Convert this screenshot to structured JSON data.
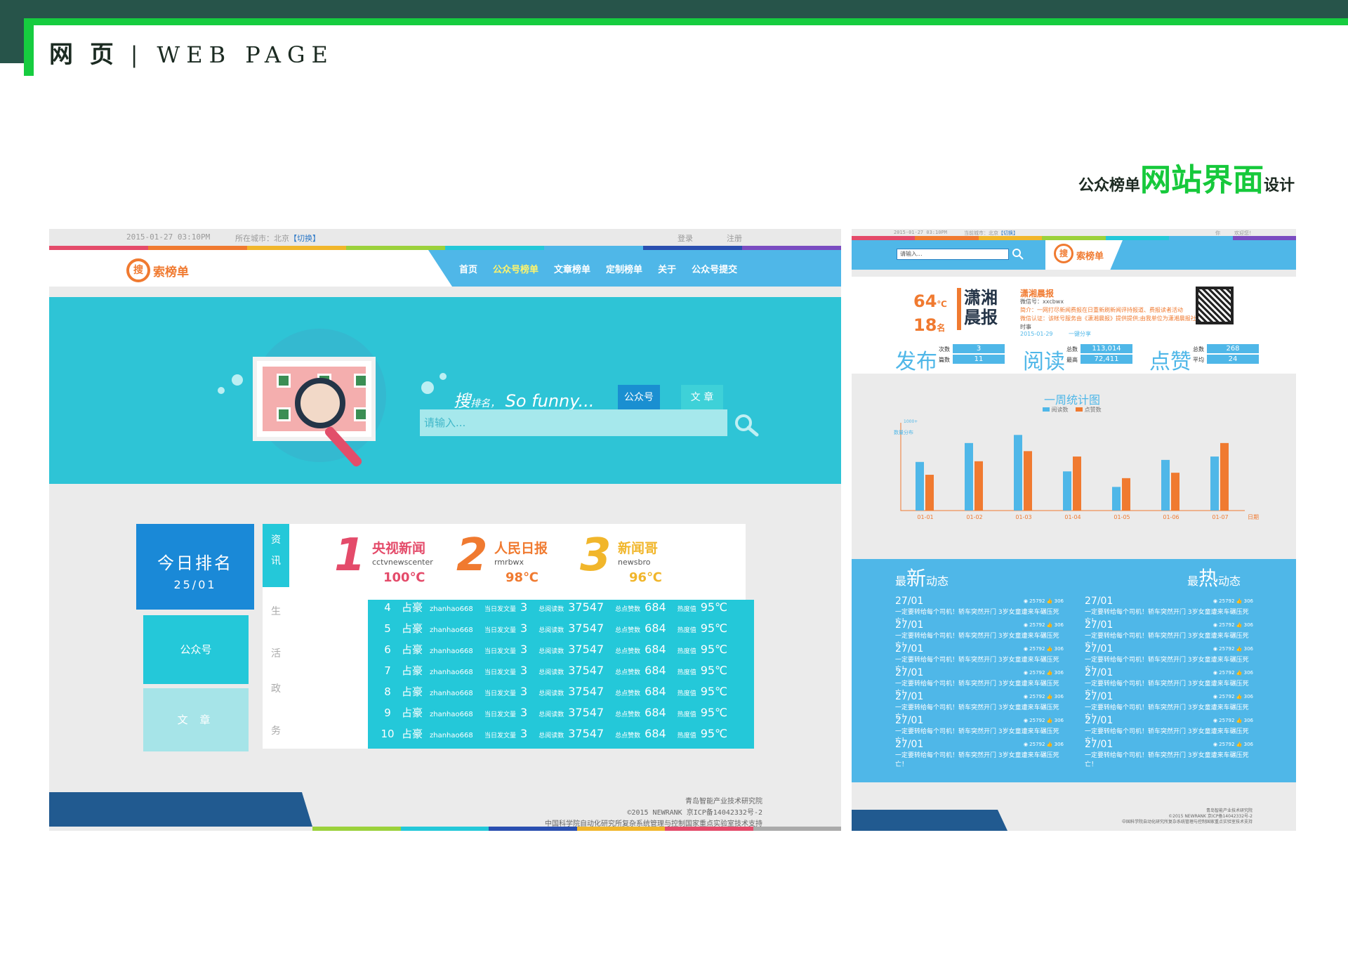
{
  "page": {
    "heading": "网 页",
    "heading_sep": "|",
    "heading_sub": "WEB PAGE",
    "design_prefix": "公众榜单",
    "design_big": "网站界面",
    "design_suffix": "设计",
    "colors": {
      "dark": "#27544a",
      "green": "#16cc3f",
      "blue": "#4fb7e8",
      "cyan": "#24c8d9",
      "orange": "#f07a30"
    }
  },
  "left": {
    "topbar": {
      "date": "2015-01-27 03:10PM",
      "city": "所在城市：北京",
      "switch": "【切换】",
      "login": "登录",
      "register": "注册"
    },
    "logo": {
      "icon_char": "搜",
      "text": "索榜单"
    },
    "nav": [
      "首页",
      "公众号榜单",
      "文章榜单",
      "定制榜单",
      "关于",
      "公众号提交"
    ],
    "hero": {
      "slogan_big": "搜",
      "slogan_small": "排名，",
      "slogan_tail": "So  funny...",
      "tab1": "公众号",
      "tab2": "文 章",
      "placeholder": "请输入..."
    },
    "today": {
      "title": "今日排名",
      "date": "25/01"
    },
    "cat1": "公众号",
    "cat2": "文 章",
    "vtabs": [
      "资",
      "讯",
      "生",
      "活",
      "政",
      "务"
    ],
    "top3": [
      {
        "rank": "1",
        "name": "央视新闻",
        "id": "cctvnewscenter",
        "score": "100",
        "unit": "℃",
        "color": "#e44b6a"
      },
      {
        "rank": "2",
        "name": "人民日报",
        "id": "rmrbwx",
        "score": "98",
        "unit": "℃",
        "color": "#f07a30"
      },
      {
        "rank": "3",
        "name": "新闻哥",
        "id": "newsbro",
        "score": "96",
        "unit": "℃",
        "color": "#f1b62b"
      }
    ],
    "list_labels": {
      "today": "当日发文量",
      "reads": "总阅读数",
      "likes": "总点赞数",
      "heat": "热度值"
    },
    "list": [
      {
        "n": "4",
        "name": "占豪",
        "acct": "zhanhao668",
        "today": "3",
        "reads": "37547",
        "likes": "684",
        "heat": "95℃"
      },
      {
        "n": "5",
        "name": "占豪",
        "acct": "zhanhao668",
        "today": "3",
        "reads": "37547",
        "likes": "684",
        "heat": "95℃"
      },
      {
        "n": "6",
        "name": "占豪",
        "acct": "zhanhao668",
        "today": "3",
        "reads": "37547",
        "likes": "684",
        "heat": "95℃"
      },
      {
        "n": "7",
        "name": "占豪",
        "acct": "zhanhao668",
        "today": "3",
        "reads": "37547",
        "likes": "684",
        "heat": "95℃"
      },
      {
        "n": "8",
        "name": "占豪",
        "acct": "zhanhao668",
        "today": "3",
        "reads": "37547",
        "likes": "684",
        "heat": "95℃"
      },
      {
        "n": "9",
        "name": "占豪",
        "acct": "zhanhao668",
        "today": "3",
        "reads": "37547",
        "likes": "684",
        "heat": "95℃"
      },
      {
        "n": "10",
        "name": "占豪",
        "acct": "zhanhao668",
        "today": "3",
        "reads": "37547",
        "likes": "684",
        "heat": "95℃"
      }
    ],
    "footer": [
      "青岛智能产业技术研究院",
      "©2015 NEWRANK 京ICP备14042332号-2",
      "中国科学院自动化研究所复杂系统管理与控制国家重点实验室技术支持"
    ]
  },
  "right": {
    "topbar": {
      "date": "2015-01-27 03:10PM",
      "city": "当前城市：北京",
      "switch": "【切换】",
      "login": "你",
      "register": "欢迎您！"
    },
    "search_placeholder": "请输入...",
    "logo": {
      "icon_char": "搜",
      "text": "索榜单"
    },
    "temp": {
      "t1": "64",
      "u1": "℃",
      "t2": "18",
      "u2": "名"
    },
    "paper_logo": "潇湘晨报",
    "paper": {
      "title": "潇湘晨报",
      "account": "微信号：xxcbwx",
      "intro": "简介：一网打尽新闻费报在日重新刷新闻评持报道、费报读者活动",
      "cert": "微信认证：该帐号服务由《潇湘晨报》提供提供;由我单位为潇湘晨报社.",
      "tag": "时事",
      "date": "2015-01-29",
      "share": "一键分享"
    },
    "stats": [
      {
        "big": "发布",
        "k1": "次数",
        "v1": "3",
        "k2": "篇数",
        "v2": "11"
      },
      {
        "big": "阅读",
        "k1": "总数",
        "v1": "113,014",
        "k2": "最高",
        "v2": "72,411"
      },
      {
        "big": "点赞",
        "k1": "总数",
        "v1": "268",
        "k2": "平均",
        "v2": "24"
      }
    ],
    "news_headers": {
      "latest_pre": "最",
      "latest_big": "新",
      "latest_post": "动态",
      "hot_pre": "最",
      "hot_big": "热",
      "hot_post": "动态"
    },
    "news_item": {
      "date": "27/01",
      "text": "一定要转给每个司机！轿车突然开门 3岁女童遭来车碾压死亡！",
      "views": "25792",
      "likes": "306"
    },
    "news_count": 7,
    "footer": [
      "青岛智能产业技术研究院",
      "©2015 NEWRANK 京ICP备14042332号-2",
      "中国科学院自动化研究所复杂系统管理与控制国家重点实验室技术支持"
    ]
  },
  "chart_data": {
    "type": "bar",
    "title": "一周统计图",
    "xlabel": "日期",
    "ylabel": "数量分布",
    "y_top_label": "1000+",
    "categories": [
      "01-01",
      "01-02",
      "01-03",
      "01-04",
      "01-05",
      "01-06",
      "01-07"
    ],
    "series": [
      {
        "name": "阅读数",
        "color": "#4fb7e8",
        "values": [
          72,
          100,
          112,
          58,
          35,
          75,
          80
        ]
      },
      {
        "name": "点赞数",
        "color": "#f07a30",
        "values": [
          53,
          73,
          88,
          80,
          48,
          56,
          100
        ]
      }
    ],
    "ylim": [
      0,
      130
    ]
  }
}
